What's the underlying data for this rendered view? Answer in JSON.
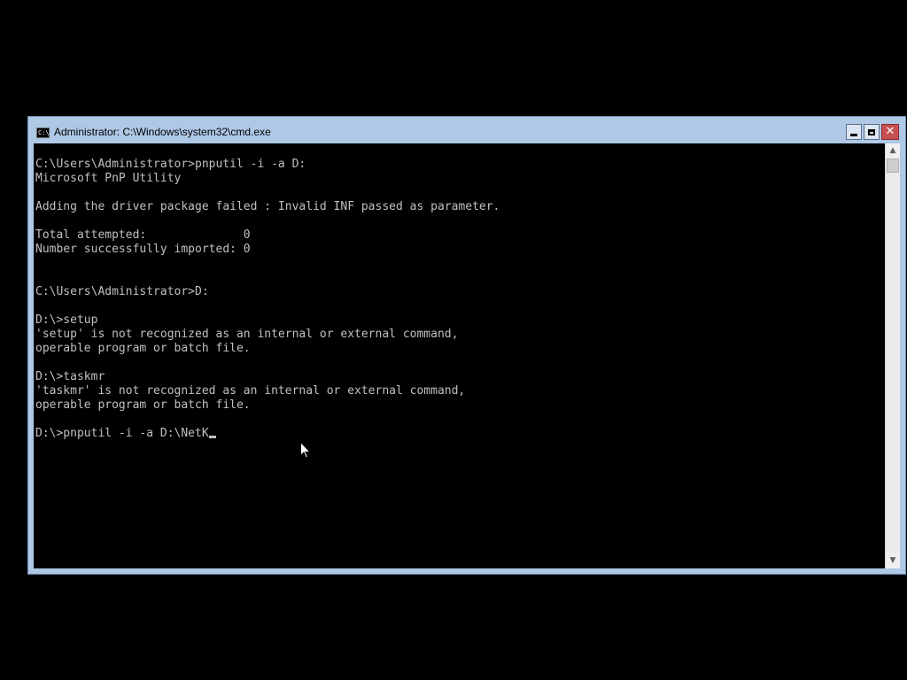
{
  "window": {
    "title": "Administrator: C:\\Windows\\system32\\cmd.exe",
    "icon_text": "C:\\",
    "controls": {
      "minimize": "minimize-icon",
      "maximize": "maximize-icon",
      "close": "✕"
    }
  },
  "console": {
    "lines": [
      "C:\\Users\\Administrator>pnputil -i -a D:",
      "Microsoft PnP Utility",
      "",
      "Adding the driver package failed : Invalid INF passed as parameter.",
      "",
      "Total attempted:              0",
      "Number successfully imported: 0",
      "",
      "",
      "C:\\Users\\Administrator>D:",
      "",
      "D:\\>setup",
      "'setup' is not recognized as an internal or external command,",
      "operable program or batch file.",
      "",
      "D:\\>taskmr",
      "'taskmr' is not recognized as an internal or external command,",
      "operable program or batch file.",
      "",
      "D:\\>pnputil -i -a D:\\NetK"
    ]
  },
  "scrollbar": {
    "up_arrow": "▲",
    "down_arrow": "▼"
  },
  "colors": {
    "titlebar": "#aec8e6",
    "console_bg": "#000000",
    "console_text": "#c0c0c0",
    "close_button": "#c75050"
  }
}
